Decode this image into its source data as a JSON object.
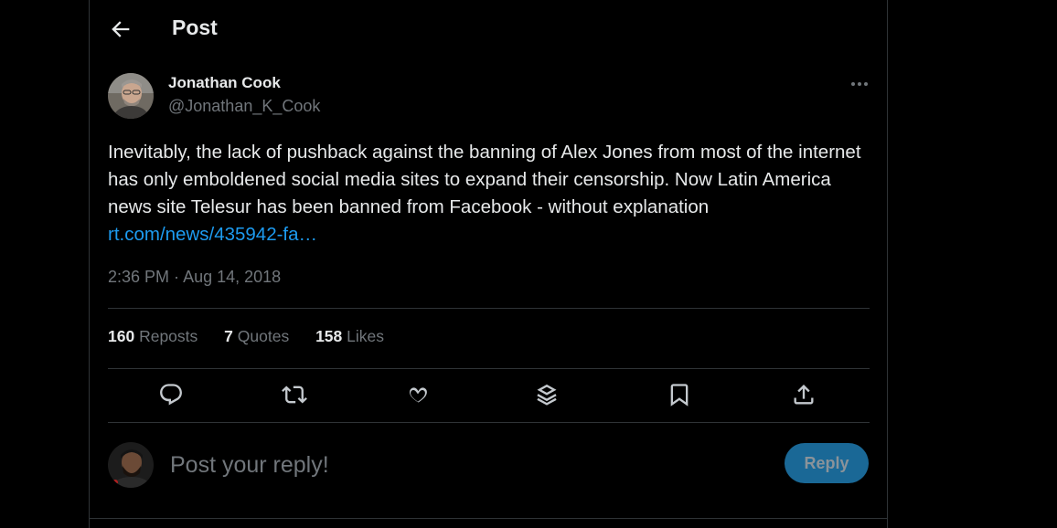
{
  "header": {
    "title": "Post",
    "back_icon": "arrow-left-icon"
  },
  "author": {
    "name": "Jonathan Cook",
    "handle": "@Jonathan_K_Cook",
    "more_icon": "more-horizontal-icon"
  },
  "tweet": {
    "text": "Inevitably, the lack of pushback against the banning of Alex Jones from most of the internet has only emboldened social media sites to expand their censorship. Now Latin America news site Telesur has been banned from Facebook - without explanation ",
    "link": "rt.com/news/435942-fa…",
    "time": "2:36 PM",
    "separator": " · ",
    "date": "Aug 14, 2018"
  },
  "stats": [
    {
      "count": "160",
      "label": "Reposts"
    },
    {
      "count": "7",
      "label": "Quotes"
    },
    {
      "count": "158",
      "label": "Likes"
    }
  ],
  "actions": [
    "reply-icon",
    "repost-icon",
    "like-icon",
    "bookmark-stack-icon",
    "bookmark-icon",
    "share-icon"
  ],
  "reply": {
    "placeholder": "Post your reply!",
    "button_label": "Reply"
  },
  "colors": {
    "background": "#000000",
    "text": "#e7e9ea",
    "muted": "#71767b",
    "link": "#1d9bf0",
    "reply_button": "#1a6896",
    "border": "#2f3336"
  }
}
